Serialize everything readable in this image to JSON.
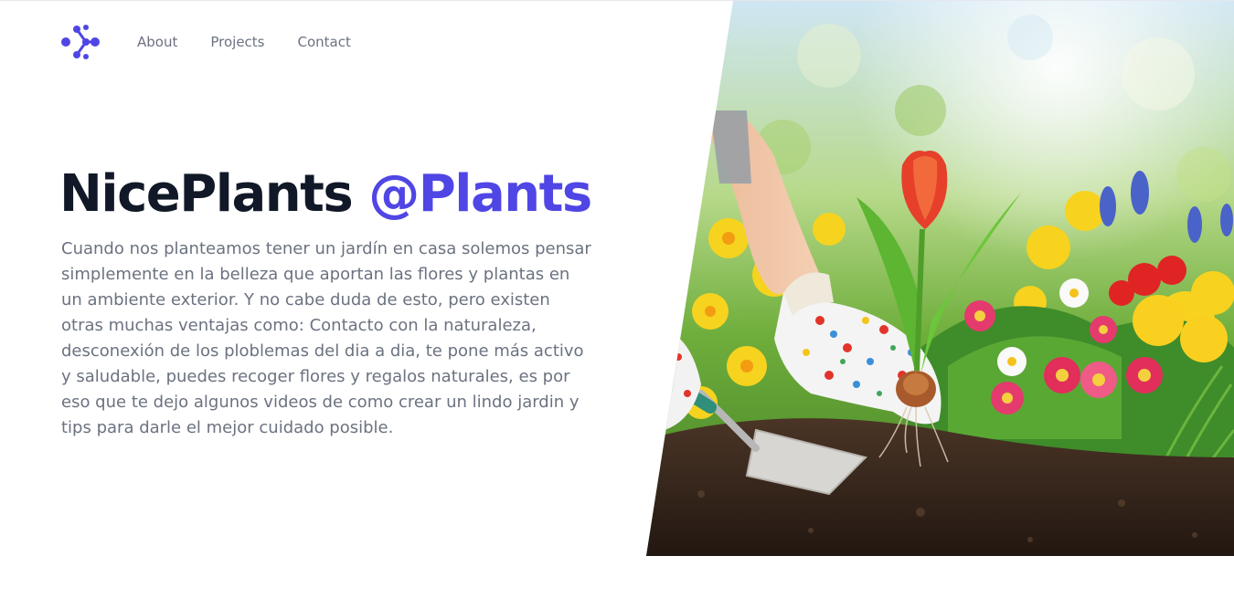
{
  "nav": {
    "logo_icon": "molecule-logo-icon",
    "links": [
      "About",
      "Projects",
      "Contact"
    ]
  },
  "hero": {
    "title_main": "NicePlants",
    "title_accent": "@Plants",
    "description": "Cuando nos planteamos tener un jardín en casa solemos pensar simplemente en la belleza que aportan las flores y plantas en un ambiente exterior. Y no cabe duda de esto, pero existen otras muchas ventajas como: Contacto con la naturaleza, desconexión de los ploblemas del dia a dia, te pone más activo y saludable, puedes recoger flores y regalos naturales, es por eso que te dejo algunos videos de como crear un lindo jardin y tips para darle el mejor cuidado posible."
  },
  "colors": {
    "accent": "#4f46e5",
    "heading": "#111827",
    "body_text": "#6b7280"
  }
}
